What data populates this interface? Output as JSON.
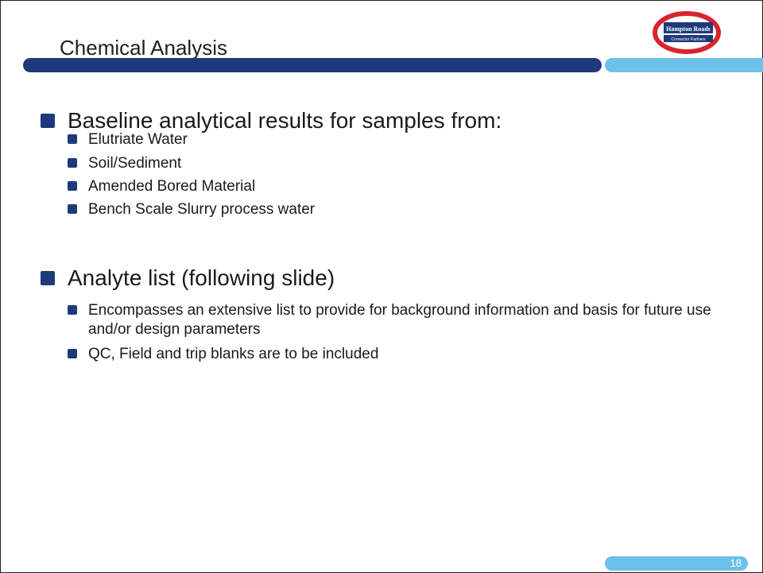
{
  "slide": {
    "title": "Chemical Analysis",
    "page_number": "18"
  },
  "logo": {
    "line1": "Hampton Roads",
    "line2": "Connector Partners"
  },
  "sections": [
    {
      "heading": "Baseline analytical results for samples from:",
      "items": [
        "Elutriate Water",
        "Soil/Sediment",
        "Amended Bored Material",
        "Bench Scale Slurry process water"
      ]
    },
    {
      "heading": "Analyte list (following slide)",
      "items": [
        "Encompasses an extensive list to provide for background information and basis for future use and/or design parameters",
        "QC, Field and trip blanks are to be included"
      ]
    }
  ],
  "colors": {
    "primary_bar": "#1e3a7a",
    "accent_bar": "#6cc0ea",
    "logo_red": "#d9232e",
    "logo_navy": "#1e3a7a"
  }
}
